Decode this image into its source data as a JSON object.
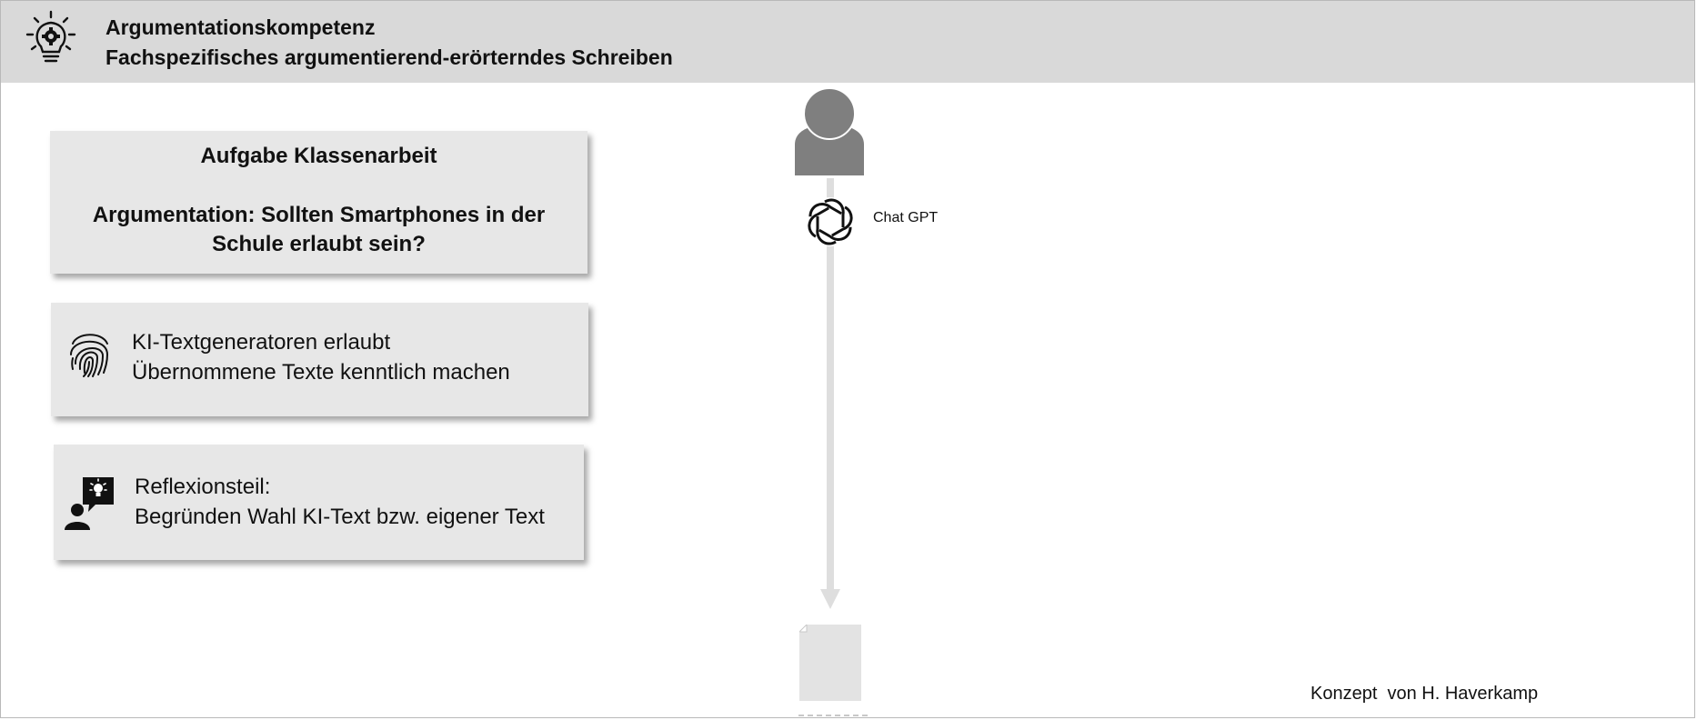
{
  "header": {
    "title": "Argumentationskompetenz",
    "subtitle": "Fachspezifisches argumentierend-erörterndes Schreiben",
    "icon": "lightbulb-gear-icon"
  },
  "cards": {
    "task": {
      "title": "Aufgabe Klassenarbeit",
      "body": "Argumentation: Sollten Smartphones in der Schule erlaubt sein?"
    },
    "ai_rules": {
      "icon": "fingerprint-icon",
      "line1": "KI-Textgeneratoren erlaubt",
      "line2": "Übernommene Texte kenntlich machen"
    },
    "reflection": {
      "icon": "person-idea-icon",
      "line1": "Reflexionsteil:",
      "line2": "Begründen Wahl KI-Text bzw. eigener Text"
    }
  },
  "flow": {
    "tool_label": "Chat GPT",
    "tool_icon": "openai-logo-icon",
    "person_icon": "person-icon",
    "document_icon": "document-icon"
  },
  "footer": {
    "credit": "Konzept  von H. Haverkamp"
  },
  "colors": {
    "header_bg": "#d9d9d9",
    "card_bg": "#e7e7e7",
    "flow_gray": "#dedede",
    "person_gray": "#7f7f7f"
  }
}
